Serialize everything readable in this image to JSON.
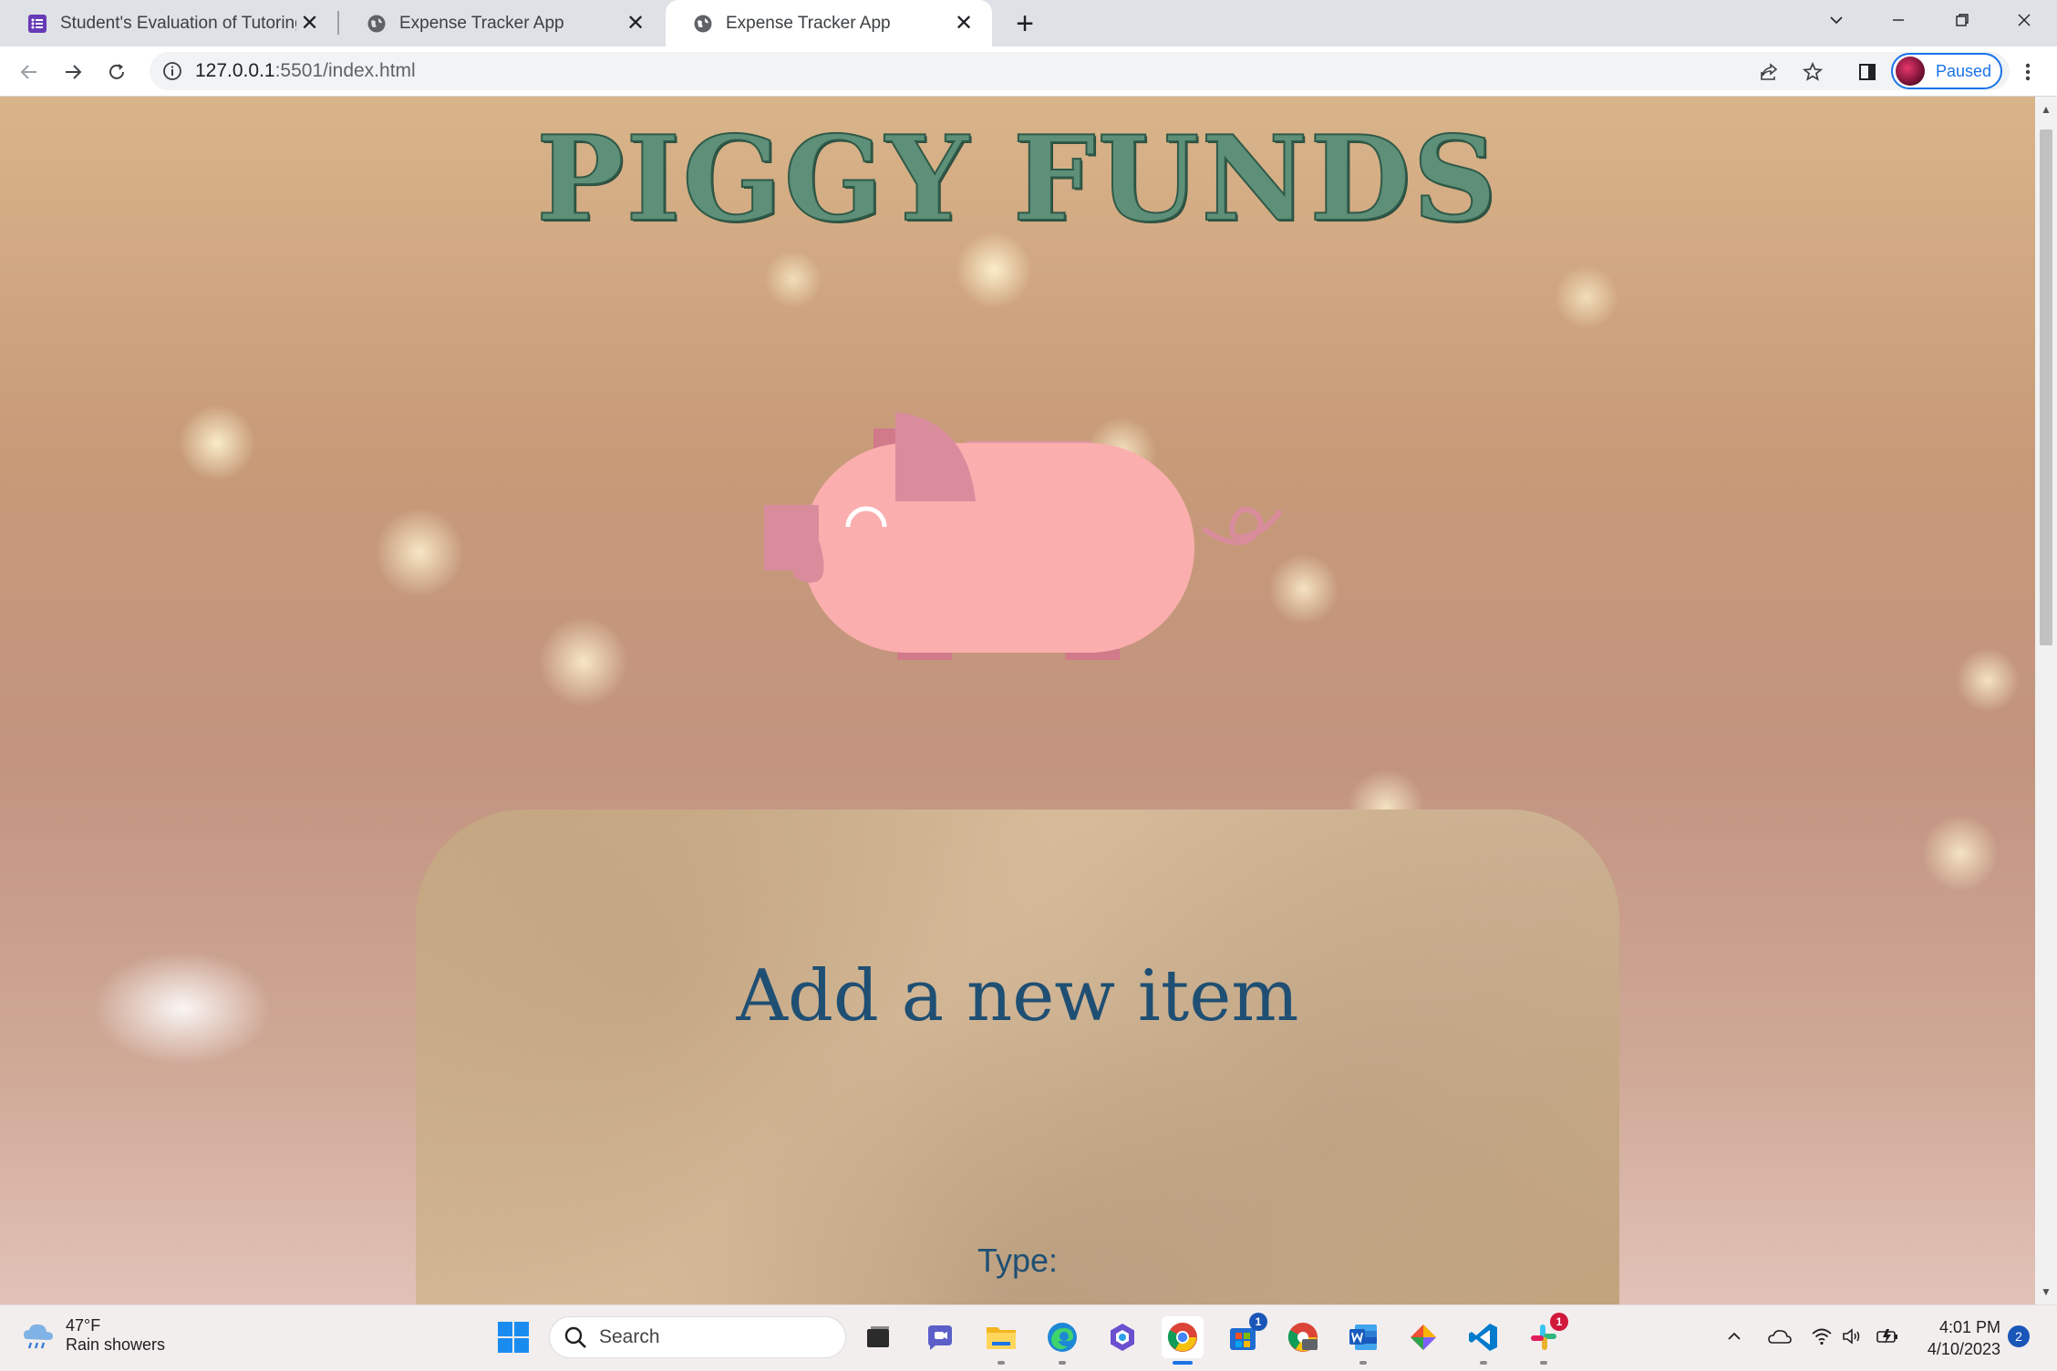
{
  "browser": {
    "tabs": [
      {
        "title": "Student's Evaluation of Tutoring",
        "icon": "forms-icon",
        "active": false
      },
      {
        "title": "Expense Tracker App",
        "icon": "globe-icon",
        "active": false
      },
      {
        "title": "Expense Tracker App",
        "icon": "globe-icon",
        "active": true
      }
    ],
    "address": {
      "host": "127.0.0.1",
      "rest": ":5501/index.html"
    },
    "profile_status": "Paused"
  },
  "page": {
    "app_title": "PIGGY FUNDS",
    "card_heading": "Add a new item",
    "type_label": "Type:"
  },
  "taskbar": {
    "weather": {
      "temp": "47°F",
      "condition": "Rain showers"
    },
    "search_placeholder": "Search",
    "store_badge": "1",
    "slack_badge": "1",
    "time": "4:01 PM",
    "date": "4/10/2023",
    "notifications": "2"
  },
  "colors": {
    "title_green": "#5e8f78",
    "heading_blue": "#1f4f73",
    "pig_pink": "#fbaeae",
    "pig_dark_pink": "#d98c9c"
  }
}
